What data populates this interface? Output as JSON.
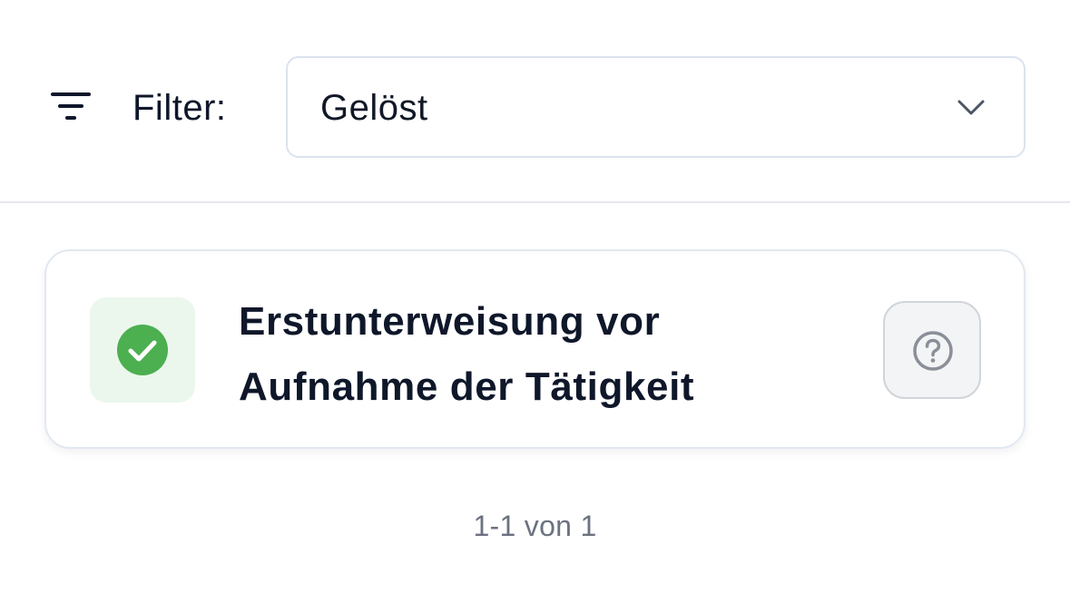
{
  "filter": {
    "icon": "filter-lines-icon",
    "label": "Filter:",
    "selected_value": "Gelöst",
    "dropdown_icon": "chevron-down-icon"
  },
  "tasks": [
    {
      "status_icon": "check-circle-icon",
      "status_color": "#4caf50",
      "status_bg": "#ebf7ec",
      "title": "Erstunterweisung vor Aufnahme der Tätigkeit",
      "help_icon": "question-circle-icon"
    }
  ],
  "pagination": {
    "text": "1-1 von 1"
  }
}
